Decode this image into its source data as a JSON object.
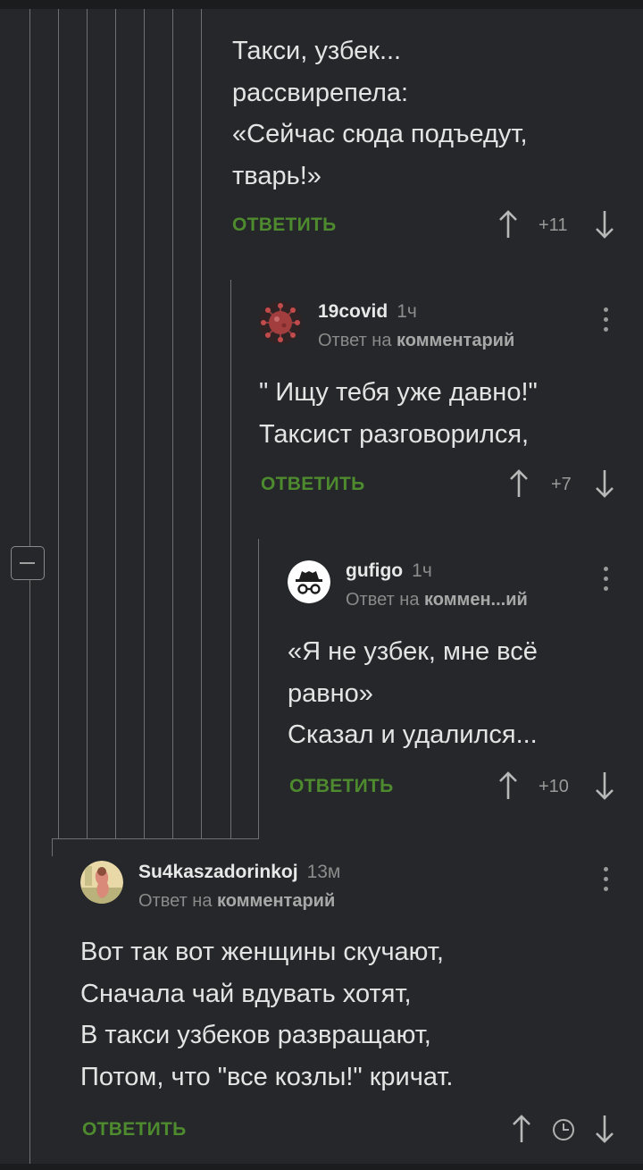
{
  "comments": [
    {
      "lines": [
        "Такси, узбек...",
        "рассвирепела:",
        "«Сейчас сюда подъедут,",
        "тварь!»"
      ],
      "reply_label": "ОТВЕТИТЬ",
      "rating": "+11"
    },
    {
      "author": "19covid",
      "time": "1ч",
      "reply_prefix": "Ответ на",
      "reply_target": "комментарий",
      "avatar": "virus-avatar-icon",
      "lines": [
        "\" Ищу тебя уже давно!\"",
        "Таксист разговорился,"
      ],
      "reply_label": "ОТВЕТИТЬ",
      "rating": "+7"
    },
    {
      "author": "gufigo",
      "time": "1ч",
      "reply_prefix": "Ответ на",
      "reply_target": "коммен...ий",
      "avatar": "incognito-avatar-icon",
      "lines": [
        "«Я не узбек, мне всё",
        "равно»",
        "Сказал и удалился..."
      ],
      "reply_label": "ОТВЕТИТЬ",
      "rating": "+10"
    },
    {
      "author": "Su4kaszadorinkoj",
      "time": "13м",
      "reply_prefix": "Ответ на",
      "reply_target": "комментарий",
      "avatar": "photo-avatar",
      "lines": [
        "Вот так вот женщины скучают,",
        "Сначала чай вдувать хотят,",
        "В такси узбеков развращают,",
        "Потом, что \"все козлы!\" кричат."
      ],
      "reply_label": "ОТВЕТИТЬ",
      "rating_icon": "clock-icon"
    }
  ],
  "colors": {
    "background": "#25272a",
    "reply_green": "#4e8a2e",
    "thread_line": "#707070",
    "text": "#e4e4e4"
  }
}
